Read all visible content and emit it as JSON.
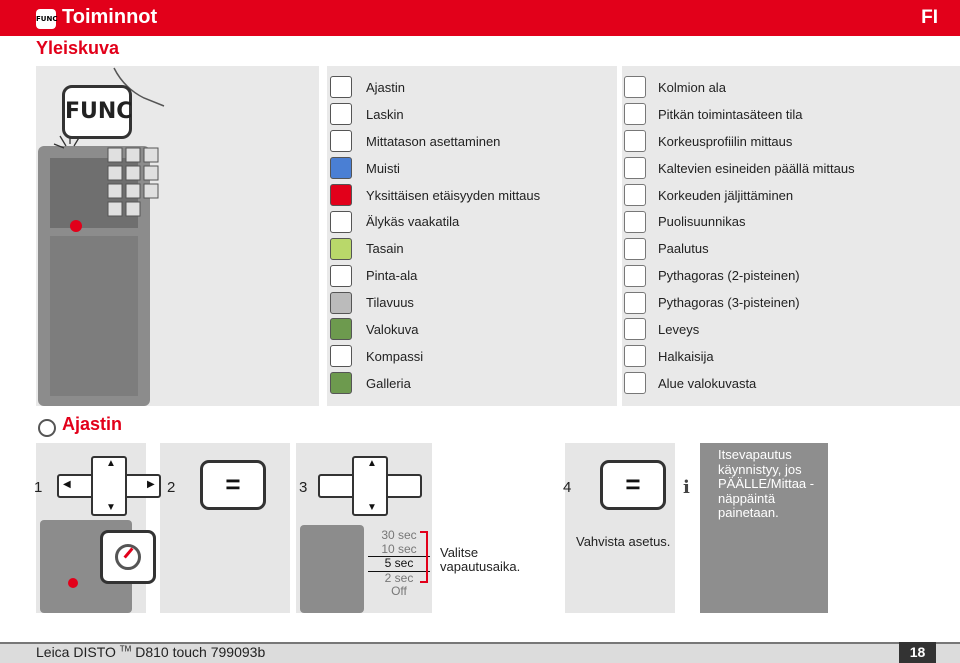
{
  "header": {
    "func_badge": "FUNC",
    "title": "Toiminnot",
    "language": "FI",
    "subtitle": "Yleiskuva"
  },
  "overview": {
    "func_key_label": "FUNC",
    "functions_left": [
      {
        "label": "Ajastin",
        "icon": "timer-icon"
      },
      {
        "label": "Laskin",
        "icon": "calculator-icon"
      },
      {
        "label": "Mittatason asettaminen",
        "icon": "reference-plane-icon"
      },
      {
        "label": "Muisti",
        "icon": "memory-icon"
      },
      {
        "label": "Yksittäisen etäisyyden mittaus",
        "icon": "single-distance-icon"
      },
      {
        "label": "Älykäs vaakatila",
        "icon": "smart-horizontal-icon"
      },
      {
        "label": "Tasain",
        "icon": "level-icon"
      },
      {
        "label": "Pinta-ala",
        "icon": "area-icon"
      },
      {
        "label": "Tilavuus",
        "icon": "volume-icon"
      },
      {
        "label": "Valokuva",
        "icon": "photo-icon"
      },
      {
        "label": "Kompassi",
        "icon": "compass-icon"
      },
      {
        "label": "Galleria",
        "icon": "gallery-icon"
      }
    ],
    "functions_right": [
      {
        "label": "Kolmion ala",
        "icon": "triangle-area-icon"
      },
      {
        "label": "Pitkän toimintasäteen tila",
        "icon": "long-range-icon"
      },
      {
        "label": "Korkeusprofiilin mittaus",
        "icon": "height-profile-icon"
      },
      {
        "label": "Kaltevien esineiden päällä mittaus",
        "icon": "slope-icon"
      },
      {
        "label": "Korkeuden jäljittäminen",
        "icon": "height-tracking-icon"
      },
      {
        "label": "Puolisuunnikas",
        "icon": "trapezoid-icon"
      },
      {
        "label": "Paalutus",
        "icon": "stake-out-icon"
      },
      {
        "label": "Pythagoras (2-pisteinen)",
        "icon": "pythagoras-2-icon"
      },
      {
        "label": "Pythagoras (3-pisteinen)",
        "icon": "pythagoras-3-icon"
      },
      {
        "label": "Leveys",
        "icon": "width-icon"
      },
      {
        "label": "Halkaisija",
        "icon": "diameter-icon"
      },
      {
        "label": "Alue valokuvasta",
        "icon": "area-from-photo-icon"
      }
    ]
  },
  "timer_section": {
    "title": "Ajastin",
    "steps": [
      "1",
      "2",
      "3",
      "4"
    ],
    "equals_label": "=",
    "timer_options": [
      "30 sec",
      "10 sec",
      "5 sec",
      "2 sec",
      "Off"
    ],
    "selected_option": "5 sec",
    "caption_select": "Valitse vapautusaika.",
    "caption_confirm": "Vahvista asetus.",
    "info_symbol": "i",
    "info_text": "Itsevapautus käynnistyy, jos PÄÄLLE/Mittaa -näppäintä painetaan."
  },
  "footer": {
    "product": "Leica DISTO",
    "trademark": "TM",
    "model": "D810 touch 799093b",
    "page": "18"
  },
  "colors": {
    "brand_red": "#e2001a",
    "panel_gray": "#e9e9e9",
    "info_gray": "#8e8e8e"
  }
}
